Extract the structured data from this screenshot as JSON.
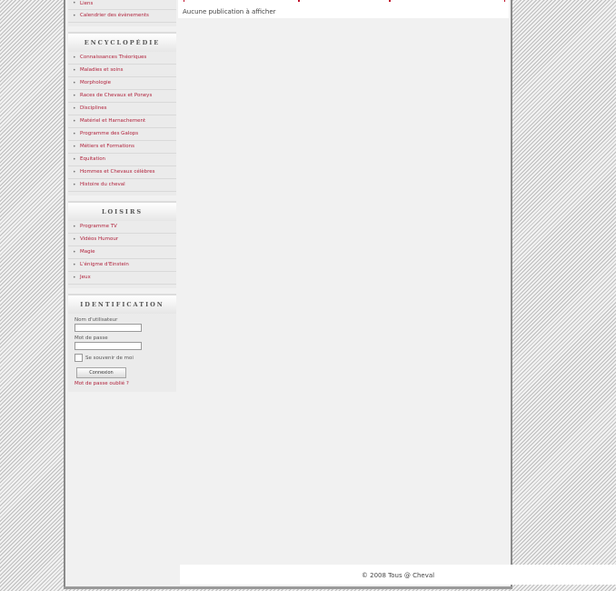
{
  "sidebar": {
    "top_items": [
      "Liens",
      "Calendrier des évènements"
    ],
    "encyclopedie": {
      "title": "ENCYCLOPÉDIE",
      "items": [
        "Connaissances Théoriques",
        "Maladies et soins",
        "Morphologie",
        "Races de Chevaux et Poneys",
        "Disciplines",
        "Matériel et Harnachement",
        "Programme des Galops",
        "Métiers et Formations",
        "Equitation",
        "Hommes et Chevaux célèbres",
        "Histoire du cheval"
      ]
    },
    "loisirs": {
      "title": "LOISIRS",
      "items": [
        "Programme TV",
        "Vidéos Humour",
        "Magie",
        "L'énigme d'Einstein",
        "Jeux"
      ]
    },
    "identification": {
      "title": "IDENTIFICATION",
      "username_label": "Nom d'utilisateur",
      "username_value": "",
      "password_label": "Mot de passe",
      "password_value": "",
      "remember_label": "Se souvenir de moi",
      "login_button": "Connexion",
      "forgot_link": "Mot de passe oublié ?"
    }
  },
  "main": {
    "notice": "Aucune publication à afficher"
  },
  "footer": {
    "copyright": "© 2008 Tous @ Cheval"
  },
  "colors": {
    "link": "#b0203a",
    "tab_border": "#c0142c"
  }
}
